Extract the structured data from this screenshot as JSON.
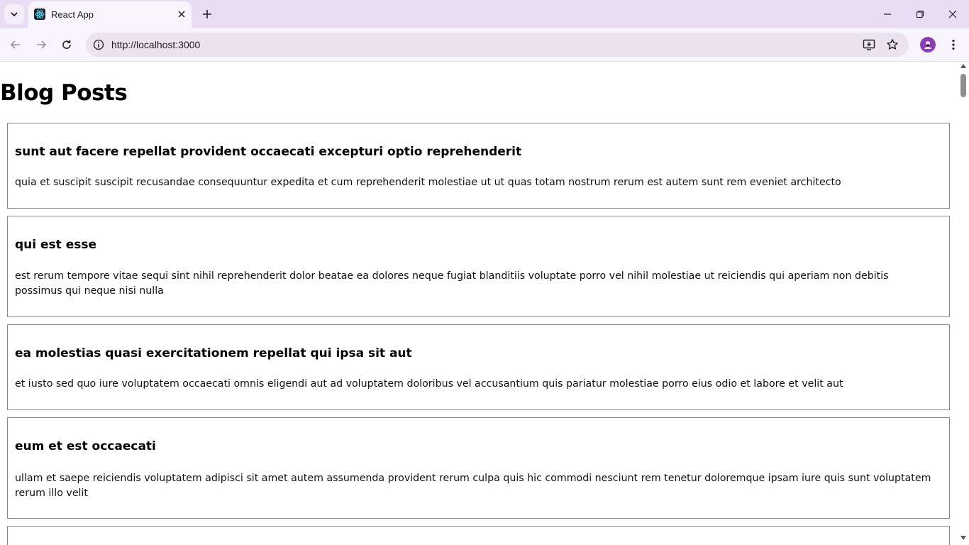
{
  "browser": {
    "tab_title": "React App",
    "url": "http://localhost:3000",
    "icons": {
      "tab_search": "chevron-down-icon",
      "favicon": "react-logo-icon",
      "tab_close": "close-icon",
      "new_tab": "plus-icon",
      "minimize": "minimize-icon",
      "restore": "restore-icon",
      "close_window": "close-icon",
      "back": "arrow-left-icon",
      "forward": "arrow-right-icon",
      "reload": "reload-icon",
      "site_info": "info-icon",
      "install_app": "install-icon",
      "bookmark": "star-icon",
      "profile": "avatar-icon",
      "menu": "kebab-menu-icon"
    },
    "colors": {
      "tabbar_bg": "#e9ddf4",
      "toolbar_bg": "#f8f4fb",
      "omnibox_bg": "#ebe3f1",
      "avatar_bg": "#8b3fb0"
    }
  },
  "page": {
    "title": "Blog Posts",
    "posts": [
      {
        "title": "sunt aut facere repellat provident occaecati excepturi optio reprehenderit",
        "body": "quia et suscipit suscipit recusandae consequuntur expedita et cum reprehenderit molestiae ut ut quas totam nostrum rerum est autem sunt rem eveniet architecto"
      },
      {
        "title": "qui est esse",
        "body": "est rerum tempore vitae sequi sint nihil reprehenderit dolor beatae ea dolores neque fugiat blanditiis voluptate porro vel nihil molestiae ut reiciendis qui aperiam non debitis possimus qui neque nisi nulla"
      },
      {
        "title": "ea molestias quasi exercitationem repellat qui ipsa sit aut",
        "body": "et iusto sed quo iure voluptatem occaecati omnis eligendi aut ad voluptatem doloribus vel accusantium quis pariatur molestiae porro eius odio et labore et velit aut"
      },
      {
        "title": "eum et est occaecati",
        "body": "ullam et saepe reiciendis voluptatem adipisci sit amet autem assumenda provident rerum culpa quis hic commodi nesciunt rem tenetur doloremque ipsam iure quis sunt voluptatem rerum illo velit"
      }
    ]
  }
}
